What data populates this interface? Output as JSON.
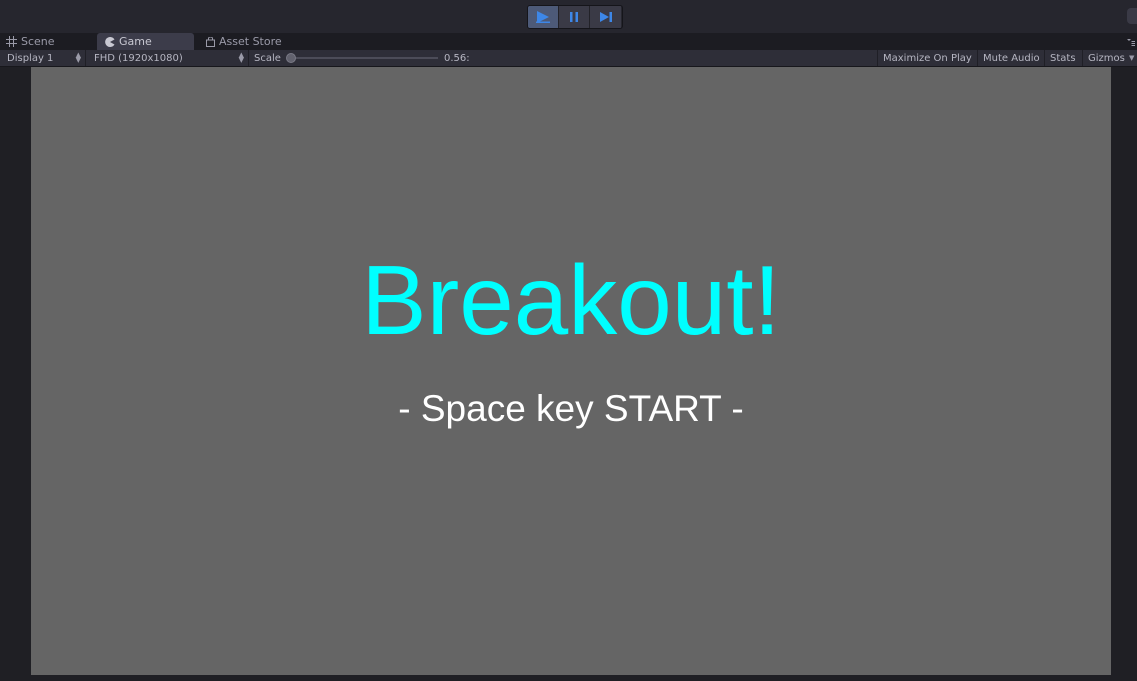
{
  "toolbar": {
    "play": {
      "icon": "play-icon",
      "state": "active"
    },
    "pause": {
      "icon": "pause-icon"
    },
    "step": {
      "icon": "step-forward-icon"
    }
  },
  "tabs": [
    {
      "label": "Scene",
      "icon": "grid-icon"
    },
    {
      "label": "Game",
      "icon": "pacman-icon",
      "active": true
    },
    {
      "label": "Asset Store",
      "icon": "shopping-bag-icon"
    }
  ],
  "game_toolbar": {
    "display": "Display 1",
    "resolution": "FHD (1920x1080)",
    "scale_label": "Scale",
    "scale_value": "0.56:",
    "maximize_on_play": "Maximize On Play",
    "mute_audio": "Mute Audio",
    "stats": "Stats",
    "gizmos": "Gizmos"
  },
  "game": {
    "title": "Breakout!",
    "subtitle": "- Space key START -",
    "title_color": "#00ffff",
    "background_color": "#656565"
  },
  "colors": {
    "editor_bg": "#202026",
    "play_active": "#4d5a78",
    "accent_blue": "#3d87e8"
  }
}
